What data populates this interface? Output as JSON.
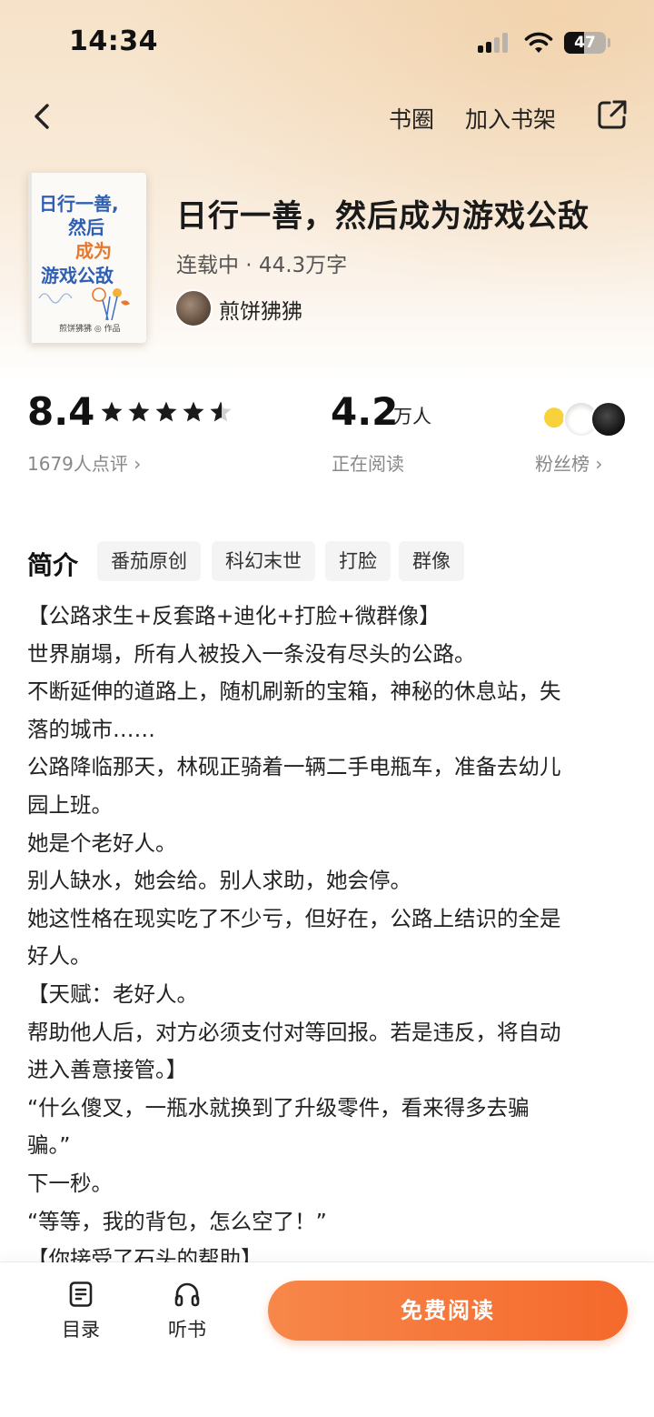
{
  "status_bar": {
    "time": "14:34",
    "battery": "47",
    "battery_level_percent": 47
  },
  "topnav": {
    "book_circle": "书圈",
    "add_to_shelf": "加入书架",
    "back_icon": "chevron-left-icon",
    "share_icon": "share-icon"
  },
  "book": {
    "cover_lines": [
      "日行一善,",
      "然后",
      "成为",
      "游戏公敌",
      "煎饼狒狒 ◎ 作品"
    ],
    "title": "日行一善，然后成为游戏公敌",
    "meta": "连载中 · 44.3万字",
    "author": "煎饼狒狒"
  },
  "stats": {
    "score": "8.4",
    "star_rating": 4.5,
    "reviews": "1679人点评 ›",
    "readers": "4.2",
    "readers_unit": "万人",
    "readers_label": "正在阅读",
    "fans_label": "粉丝榜 ›"
  },
  "intro": {
    "title": "简介",
    "tags": [
      "番茄原创",
      "科幻末世",
      "打脸",
      "群像"
    ],
    "lines": [
      "【公路求生+反套路+迪化+打脸+微群像】",
      "世界崩塌，所有人被投入一条没有尽头的公路。",
      "不断延伸的道路上，随机刷新的宝箱，神秘的休息站，失",
      "落的城市……",
      "公路降临那天，林砚正骑着一辆二手电瓶车，准备去幼儿",
      "园上班。",
      "她是个老好人。",
      "别人缺水，她会给。别人求助，她会停。",
      "她这性格在现实吃了不少亏，但好在，公路上结识的全是",
      "好人。",
      "【天赋：老好人。",
      "帮助他人后，对方必须支付对等回报。若是违反，将自动",
      "进入善意接管。】",
      "“什么傻叉，一瓶水就换到了升级零件，看来得多去骗",
      "骗。”",
      "下一秒。",
      "“等等，我的背包，怎么空了！”",
      "【你接受了石头的帮助】"
    ]
  },
  "bottombar": {
    "catalog": "目录",
    "listen": "听书",
    "read_free": "免费阅读"
  },
  "colors": {
    "accent": "#f5692c",
    "hero_bg": "#f6e2c8",
    "tag_bg": "#f4f4f5"
  }
}
